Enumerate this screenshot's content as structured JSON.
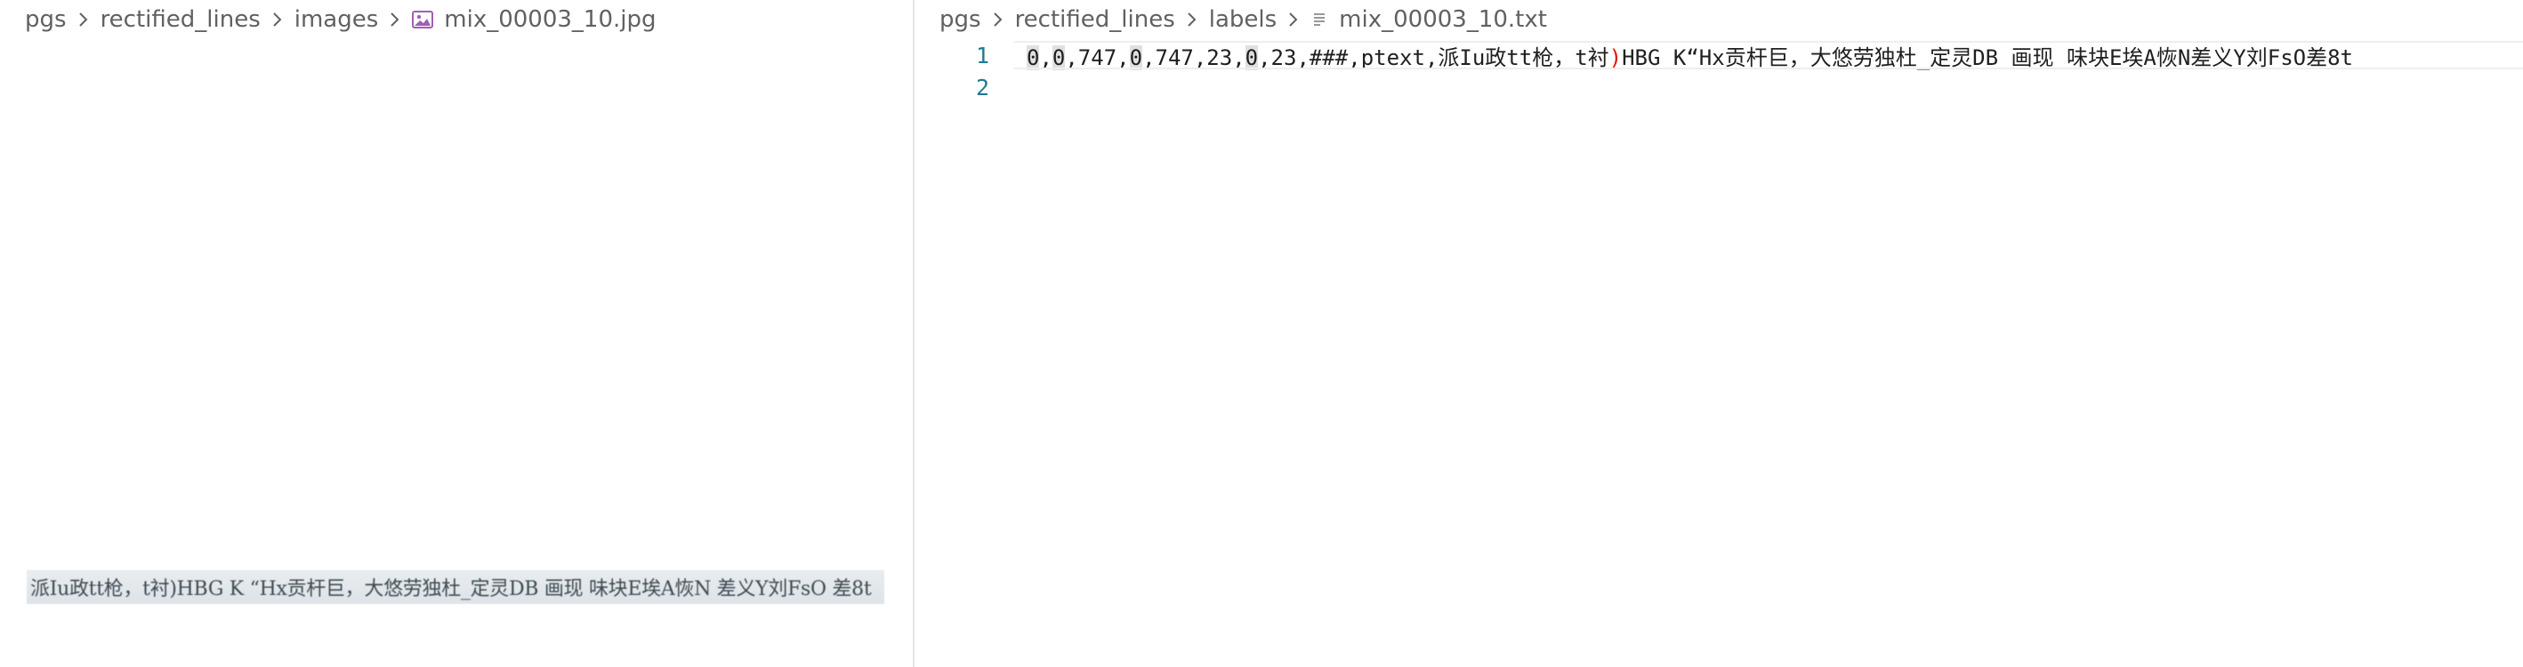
{
  "left_pane": {
    "breadcrumb": [
      "pgs",
      "rectified_lines",
      "images"
    ],
    "file_name": "mix_00003_10.jpg",
    "file_icon": "image-icon",
    "preview_text": "派Iu政tt枪，t衬)HBG K “Hx贡杆巨，大悠劳独杜_定灵DB 画现 味块E埃A恢N 差义Y刘FsO 差8t"
  },
  "right_pane": {
    "breadcrumb": [
      "pgs",
      "rectified_lines",
      "labels"
    ],
    "file_name": "mix_00003_10.txt",
    "file_icon": "text-file-icon",
    "lines": [
      {
        "number": "1",
        "segments": [
          {
            "text": "0",
            "style": "hl"
          },
          {
            "text": ",",
            "style": ""
          },
          {
            "text": "0",
            "style": "hl"
          },
          {
            "text": ",747,",
            "style": ""
          },
          {
            "text": "0",
            "style": "hl"
          },
          {
            "text": ",747,23,",
            "style": ""
          },
          {
            "text": "0",
            "style": "hl"
          },
          {
            "text": ",23,###,ptext,派Iu政tt枪，t衬",
            "style": ""
          },
          {
            "text": ")",
            "style": "paren"
          },
          {
            "text": "HBG K“Hx贡杆巨，大悠劳独杜_定灵DB 画现 味块E埃A恢N差义Y刘FsO差8t",
            "style": ""
          }
        ]
      },
      {
        "number": "2",
        "segments": []
      }
    ]
  },
  "colors": {
    "line_number": "#237893",
    "bracket_highlight": "#e51400",
    "occurrence_highlight": "#e0e0e0",
    "breadcrumb_text": "#616161",
    "image_icon": "#a05fb4"
  }
}
